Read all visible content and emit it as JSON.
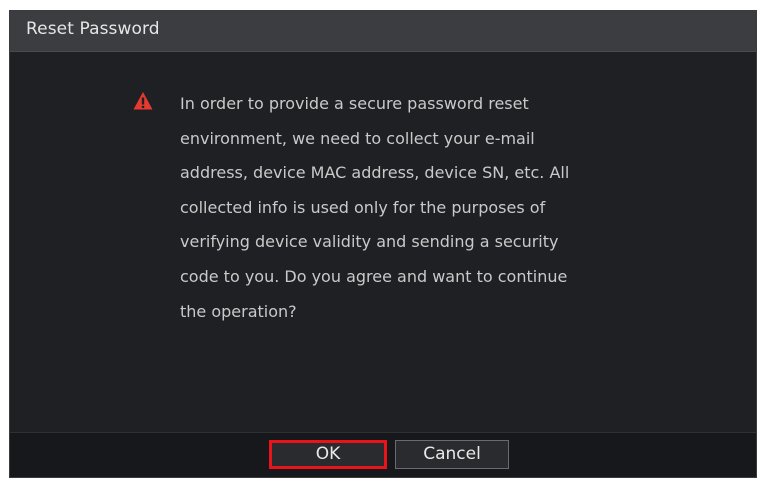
{
  "dialog": {
    "title": "Reset Password",
    "icon": "warning-icon",
    "message": "In order to provide a secure password reset\nenvironment, we need to collect your e-mail\naddress, device MAC address, device SN, etc. All\ncollected info is used only for the purposes of\nverifying device validity and sending a security\ncode to you. Do you agree and want to continue\n the operation?",
    "buttons": {
      "ok_label": "OK",
      "cancel_label": "Cancel"
    },
    "colors": {
      "highlight": "#e8131b",
      "warning": "#e53a2f"
    }
  }
}
